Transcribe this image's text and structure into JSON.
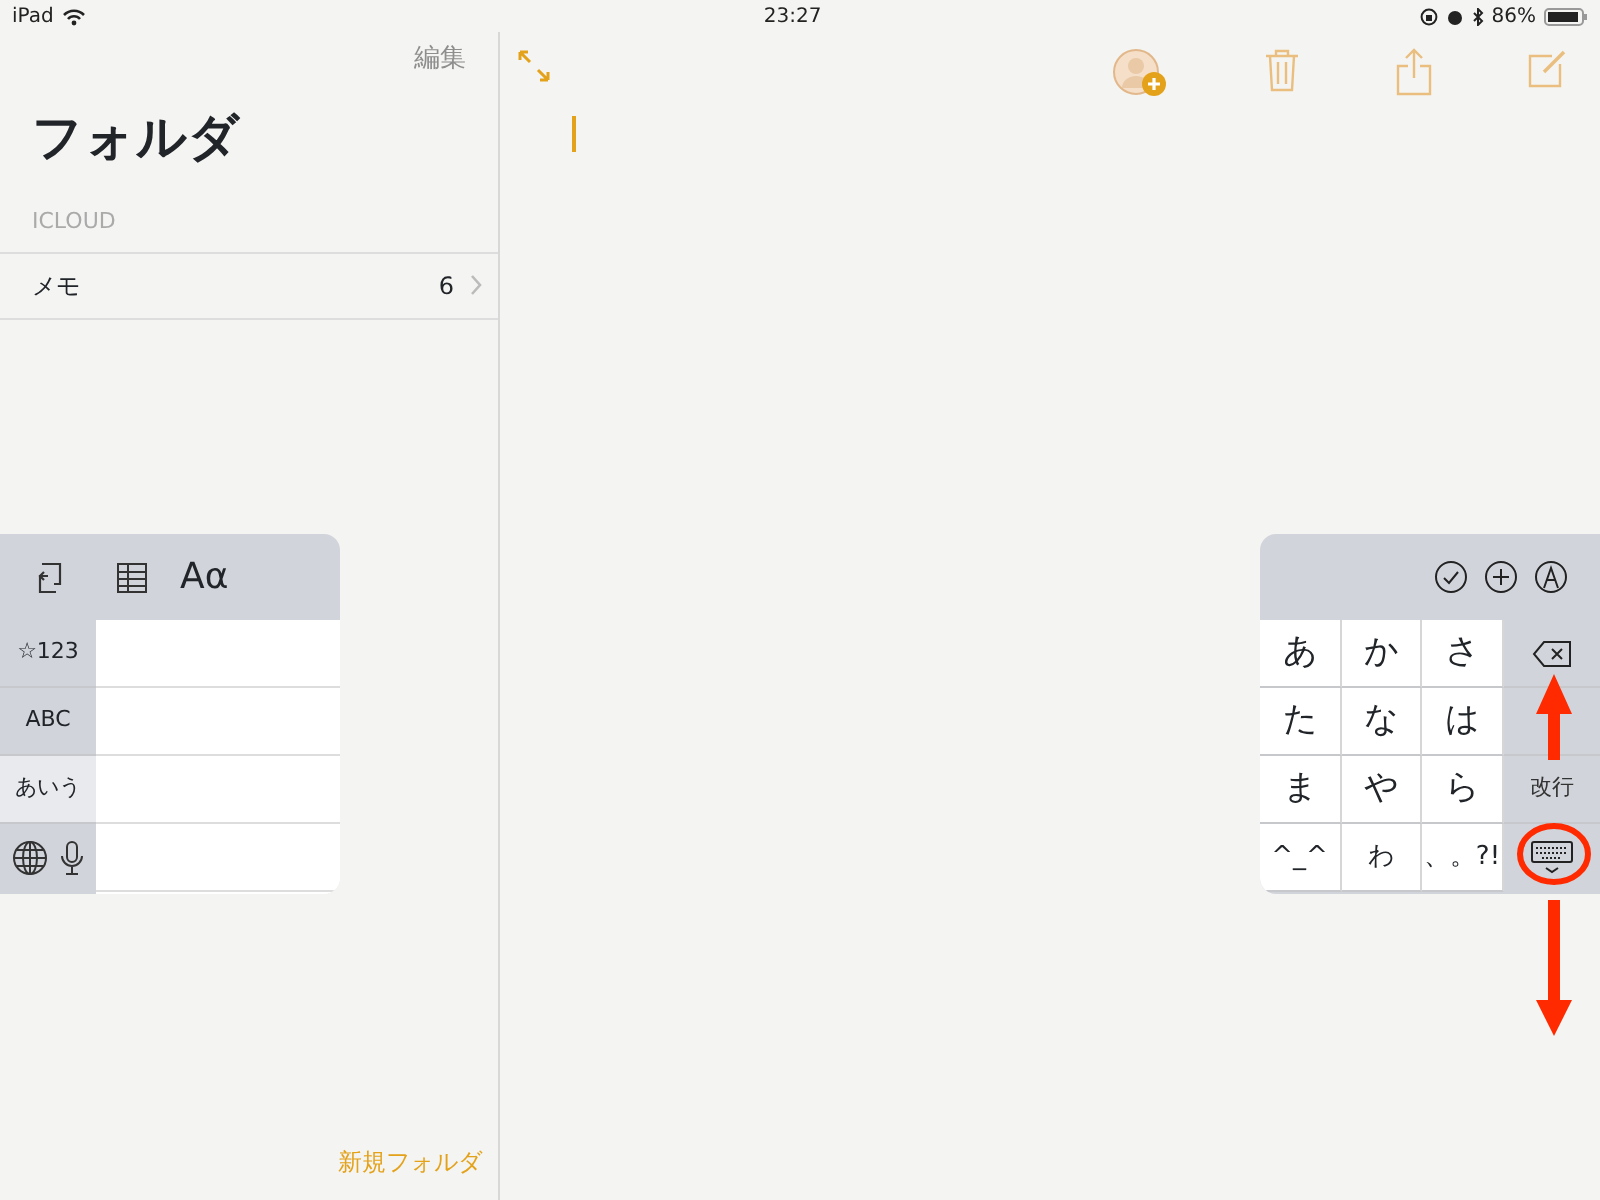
{
  "status_bar": {
    "device": "iPad",
    "time": "23:27",
    "battery": "86%"
  },
  "sidebar": {
    "edit": "編集",
    "title": "フォルダ",
    "section": "ICLOUD",
    "folders": [
      {
        "name": "メモ",
        "count": "6"
      }
    ],
    "new_folder": "新規フォルダ"
  },
  "left_keyboard": {
    "format_label": "Aα",
    "keys": [
      {
        "label": "☆123",
        "kind": "mode",
        "selected": false
      },
      {
        "label": "ABC",
        "kind": "mode",
        "selected": false
      },
      {
        "label": "あいう",
        "kind": "mode",
        "selected": true
      }
    ]
  },
  "right_keyboard": {
    "keys": [
      {
        "label": "あ"
      },
      {
        "label": "か"
      },
      {
        "label": "さ"
      },
      {
        "label": "た"
      },
      {
        "label": "な"
      },
      {
        "label": "は"
      },
      {
        "label": "ま"
      },
      {
        "label": "や"
      },
      {
        "label": "ら"
      },
      {
        "label": "^_^"
      },
      {
        "label": "わ"
      },
      {
        "label": "、。?!"
      }
    ],
    "return_key": "改行"
  }
}
